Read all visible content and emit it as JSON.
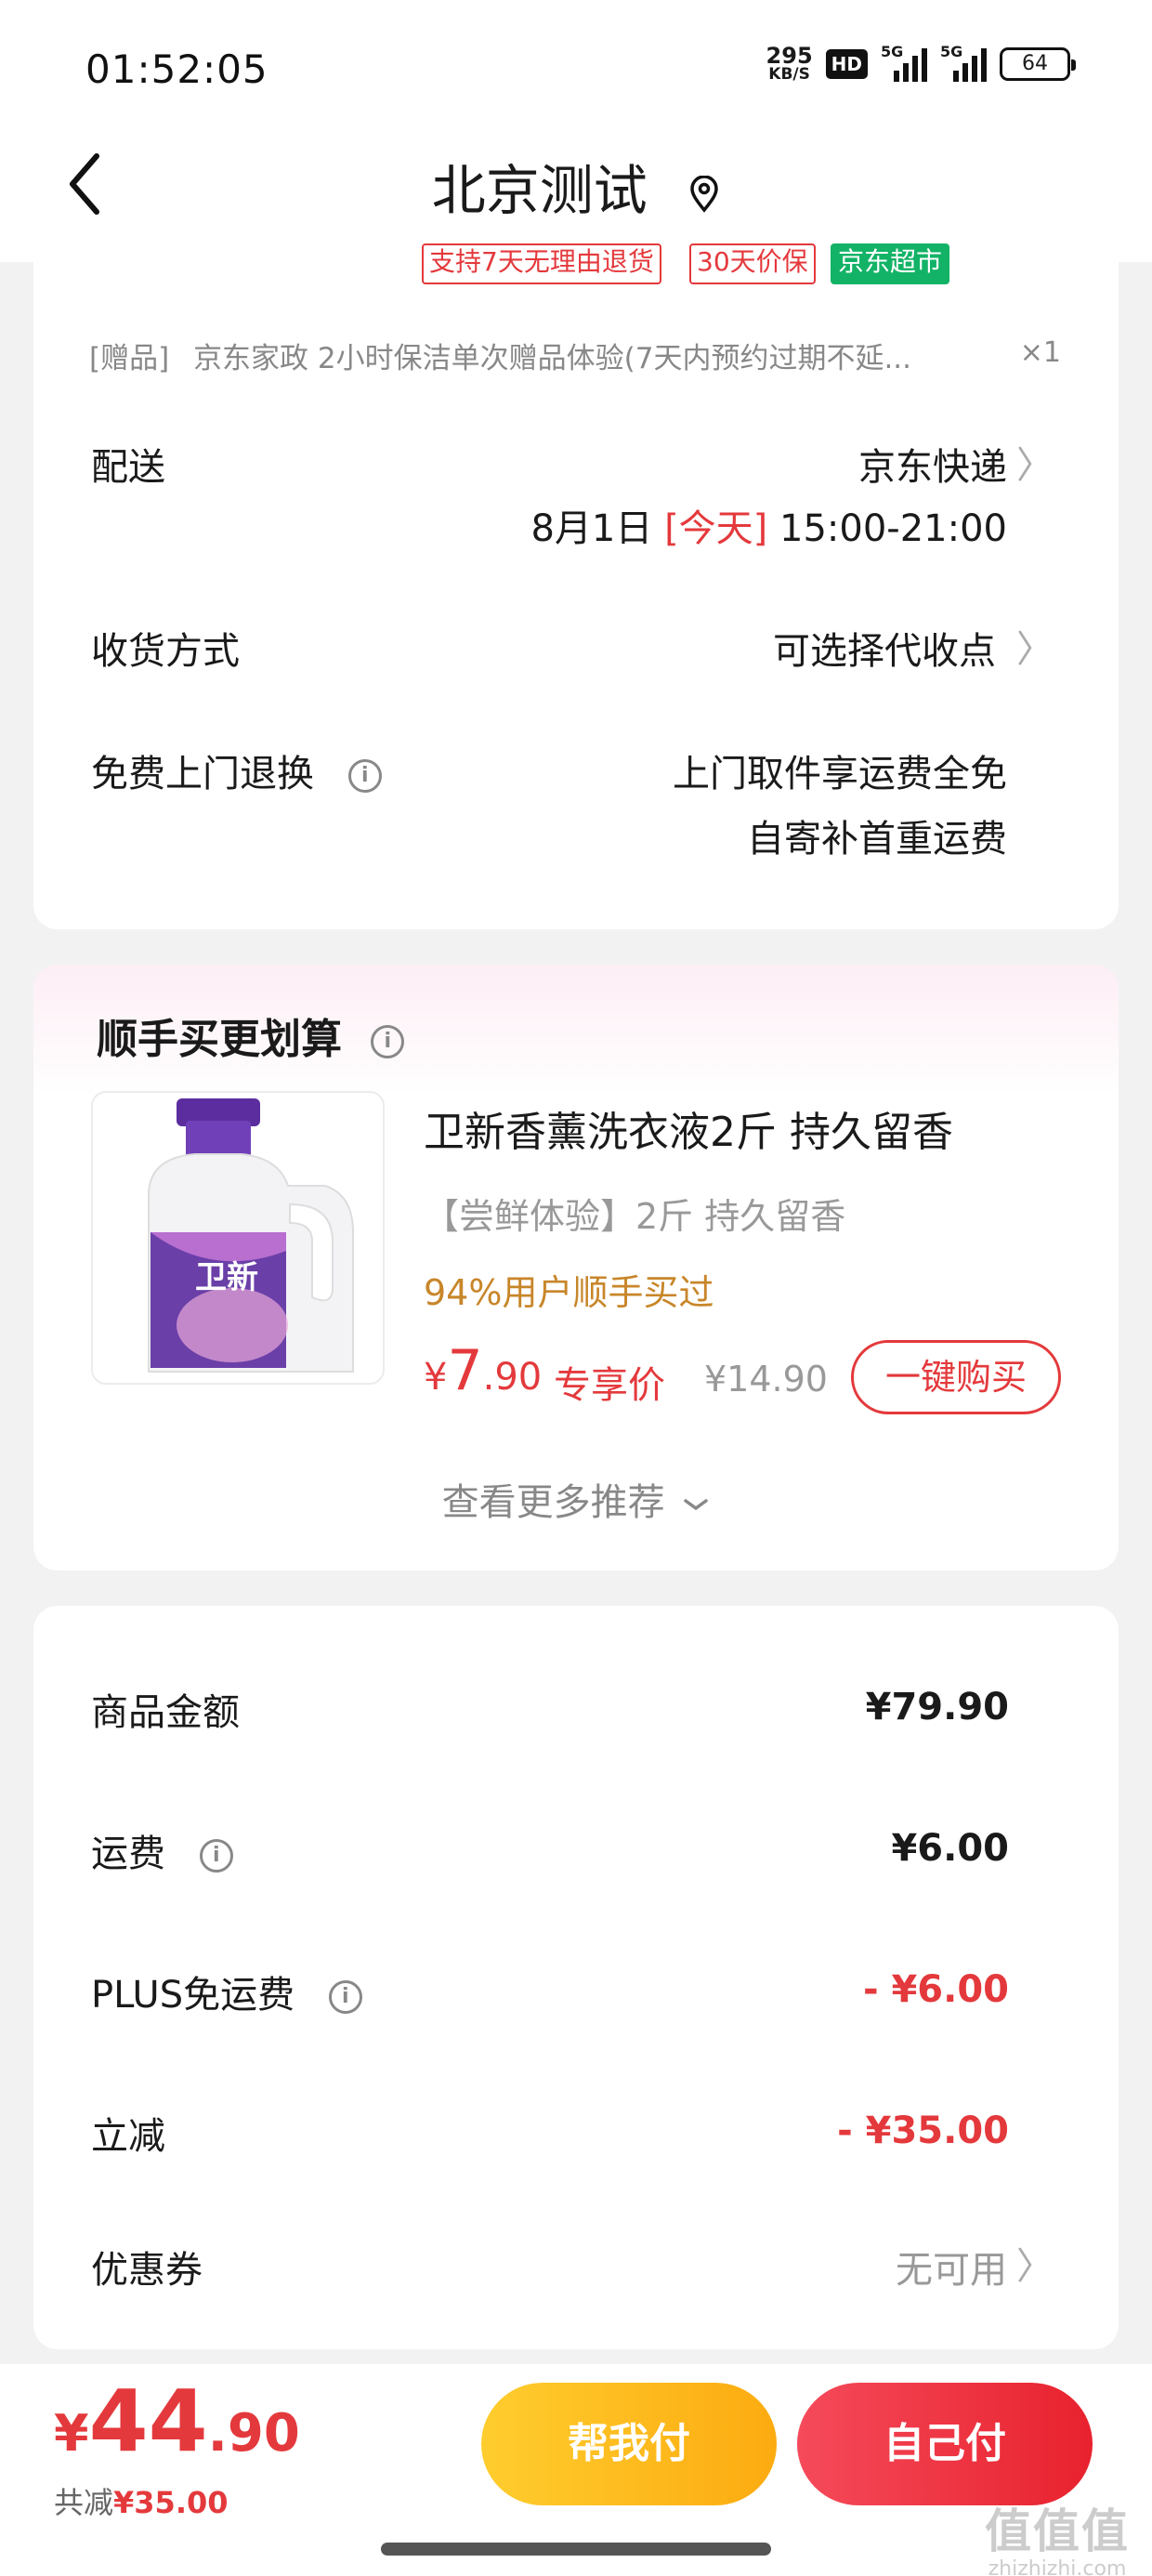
{
  "status_bar": {
    "time": "01:52:05",
    "net_speed_value": "295",
    "net_speed_unit": "KB/S",
    "hd": "HD",
    "sim1": "5G",
    "sim2": "5G",
    "battery": "64"
  },
  "nav": {
    "title": "北京测试"
  },
  "order_card": {
    "tags": [
      "支持7天无理由退货",
      "30天价保",
      "京东超市"
    ],
    "gift_prefix": "[赠品]",
    "gift_text": "京东家政 2小时保洁单次赠品体验(7天内预约过期不延...",
    "gift_qty": "×1",
    "delivery_label": "配送",
    "delivery_value": "京东快递",
    "delivery_date": "8月1日",
    "delivery_today": "[今天]",
    "delivery_time": "15:00-21:00",
    "receive_label": "收货方式",
    "receive_value": "可选择代收点",
    "return_label": "免费上门退换",
    "return_value_1": "上门取件享运费全免",
    "return_value_2": "自寄补首重运费"
  },
  "recommend": {
    "title": "顺手买更划算",
    "product_name": "卫新香薰洗衣液2斤 持久留香",
    "product_sub": "【尝鲜体验】2斤 持久留香",
    "bought_hint": "94%用户顺手买过",
    "price_symbol": "¥",
    "price_int": "7",
    "price_dec": ".90",
    "price_tag": "专享价",
    "price_old": "¥14.90",
    "buy_button": "一键购买",
    "more": "查看更多推荐",
    "image_brand": "卫新"
  },
  "summary": {
    "items": [
      {
        "label": "商品金额",
        "value": "¥79.90"
      },
      {
        "label": "运费",
        "value": "¥6.00"
      },
      {
        "label": "PLUS免运费",
        "value": "- ¥6.00"
      },
      {
        "label": "立减",
        "value": "- ¥35.00"
      },
      {
        "label": "优惠券",
        "value": "无可用"
      }
    ]
  },
  "bottom": {
    "total_symbol": "¥",
    "total_int": "44",
    "total_dec": ".90",
    "saved_label": "共减",
    "saved_value": "¥35.00",
    "help_pay": "帮我付",
    "self_pay": "自己付"
  },
  "watermark": {
    "text1": "值值值",
    "text2": "zhizhizhi.com"
  },
  "colors": {
    "accent_red": "#e4393c",
    "gold_text": "#c8862a",
    "help_btn": "#fcab10",
    "self_btn": "#e8222e",
    "tag_green": "#13b367"
  }
}
